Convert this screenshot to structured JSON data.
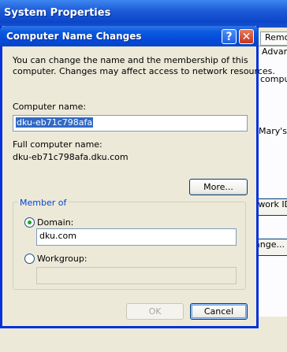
{
  "background_window": {
    "title": "System Properties",
    "tabs": [
      "Remo",
      "Advan"
    ],
    "fragments": [
      "compu",
      "Mary's",
      "twork ID",
      "ange..."
    ]
  },
  "dialog": {
    "title": "Computer Name Changes",
    "help_symbol": "?",
    "close_symbol": "✕",
    "description": [
      "You can change the name and the membership of this",
      "computer. Changes may affect access to network resources."
    ],
    "computer_name_label": "Computer name:",
    "computer_name_value": "dku-eb71c798afa",
    "full_name_label": "Full computer name:",
    "full_name_value": "dku-eb71c798afa.dku.com",
    "more_button": "More...",
    "member_of": {
      "legend": "Member of",
      "domain_label": "Domain:",
      "domain_value": "dku.com",
      "domain_selected": true,
      "workgroup_label": "Workgroup:",
      "workgroup_value": ""
    },
    "ok_button": "OK",
    "cancel_button": "Cancel"
  }
}
